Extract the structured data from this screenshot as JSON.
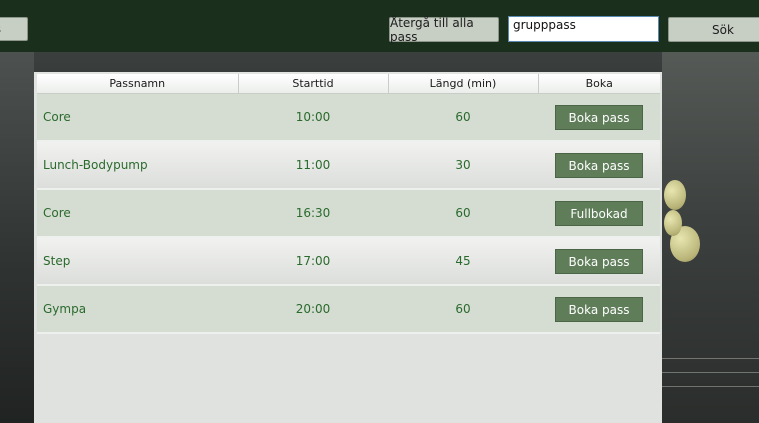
{
  "header": {
    "left_button_label": "s",
    "return_button_label": "Återgå till alla pass",
    "search_value": "grupppass",
    "search_button_label": "Sök"
  },
  "table": {
    "columns": [
      "Passnamn",
      "Starttid",
      "Längd (min)",
      "Boka"
    ],
    "rows": [
      {
        "name": "Core",
        "start": "10:00",
        "length": "60",
        "action": "Boka pass"
      },
      {
        "name": "Lunch-Bodypump",
        "start": "11:00",
        "length": "30",
        "action": "Boka pass"
      },
      {
        "name": "Core",
        "start": "16:30",
        "length": "60",
        "action": "Fullbokad"
      },
      {
        "name": "Step",
        "start": "17:00",
        "length": "45",
        "action": "Boka pass"
      },
      {
        "name": "Gympa",
        "start": "20:00",
        "length": "60",
        "action": "Boka pass"
      }
    ]
  },
  "colors": {
    "topbar": "#1b2f1d",
    "accent_button": "#5e7d58",
    "row_text": "#2a6a2c"
  }
}
